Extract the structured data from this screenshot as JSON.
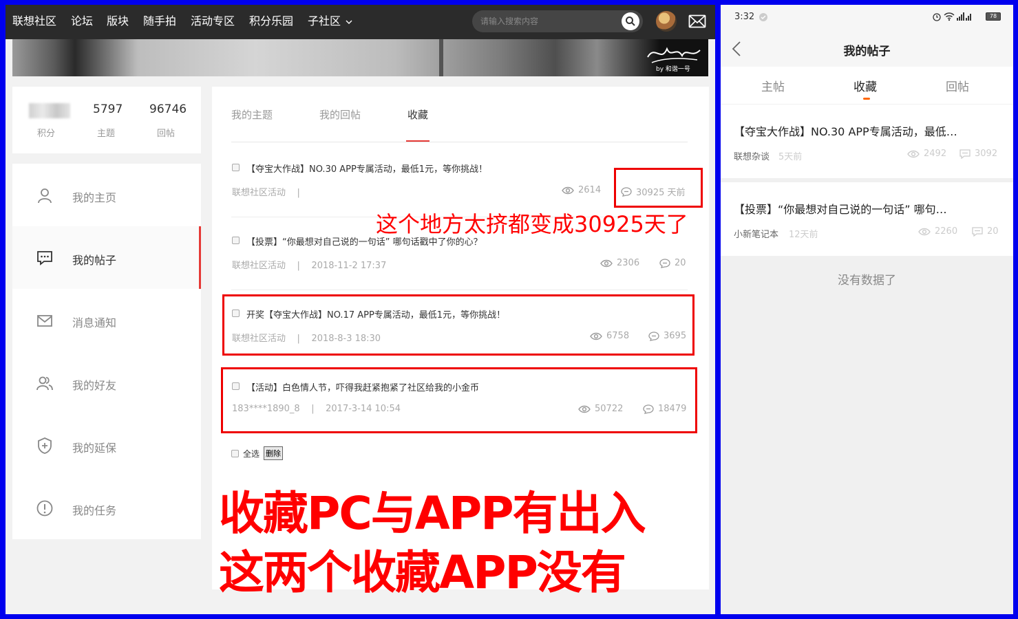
{
  "nav": {
    "items": [
      "联想社区",
      "论坛",
      "版块",
      "随手拍",
      "活动专区",
      "积分乐园",
      "子社区"
    ],
    "search_placeholder": "请输入搜索内容"
  },
  "banner": {
    "signature_text": "by 和谐一号"
  },
  "stats": [
    {
      "value": "",
      "label": "积分"
    },
    {
      "value": "5797",
      "label": "主题"
    },
    {
      "value": "96746",
      "label": "回帖"
    }
  ],
  "menu": [
    {
      "label": "我的主页",
      "icon": "user-icon"
    },
    {
      "label": "我的帖子",
      "icon": "chat-icon",
      "active": true
    },
    {
      "label": "消息通知",
      "icon": "mail-icon"
    },
    {
      "label": "我的好友",
      "icon": "friends-icon"
    },
    {
      "label": "我的延保",
      "icon": "shield-plus-icon"
    },
    {
      "label": "我的任务",
      "icon": "alert-icon"
    }
  ],
  "tabs": [
    "我的主题",
    "我的回帖",
    "收藏"
  ],
  "posts": [
    {
      "title": "【夺宝大作战】NO.30 APP专属活动，最低1元，等你挑战！",
      "source": "联想社区活动",
      "time": "",
      "views": "2614",
      "replies": "30925 天前"
    },
    {
      "title": "【投票】“你最想对自己说的一句话” 哪句话戳中了你的心？",
      "source": "联想社区活动",
      "time": "2018-11-2 17:37",
      "views": "2306",
      "replies": "20"
    },
    {
      "title": "开奖【夺宝大作战】NO.17 APP专属活动，最低1元，等你挑战！",
      "source": "联想社区活动",
      "time": "2018-8-3 18:30",
      "views": "6758",
      "replies": "3695"
    },
    {
      "title": "【活动】白色情人节，吓得我赶紧抱紧了社区给我的小金币",
      "source": "183****1890_8",
      "time": "2017-3-14 10:54",
      "views": "50722",
      "replies": "18479"
    }
  ],
  "select_all_label": "全选",
  "delete_label": "删除",
  "annotations": {
    "cramped": "这个地方太挤都变成30925天了",
    "line1": "收藏PC与APP有出入",
    "line2": "这两个收藏APP没有"
  },
  "app": {
    "time": "3:32",
    "battery": "78",
    "title": "我的帖子",
    "tabs": [
      "主帖",
      "收藏",
      "回帖"
    ],
    "items": [
      {
        "title": "【夺宝大作战】NO.30 APP专属活动，最低…",
        "source": "联想杂谈",
        "time": "5天前",
        "views": "2492",
        "replies": "3092"
      },
      {
        "title": "【投票】“你最想对自己说的一句话” 哪句…",
        "source": "小新笔记本",
        "time": "12天前",
        "views": "2260",
        "replies": "20"
      }
    ],
    "no_data": "没有数据了"
  },
  "colors": {
    "accent_red": "#e53935",
    "annotation_red": "#ff0000",
    "app_tab_orange": "#ff6600",
    "frame_blue": "#0000ee"
  }
}
